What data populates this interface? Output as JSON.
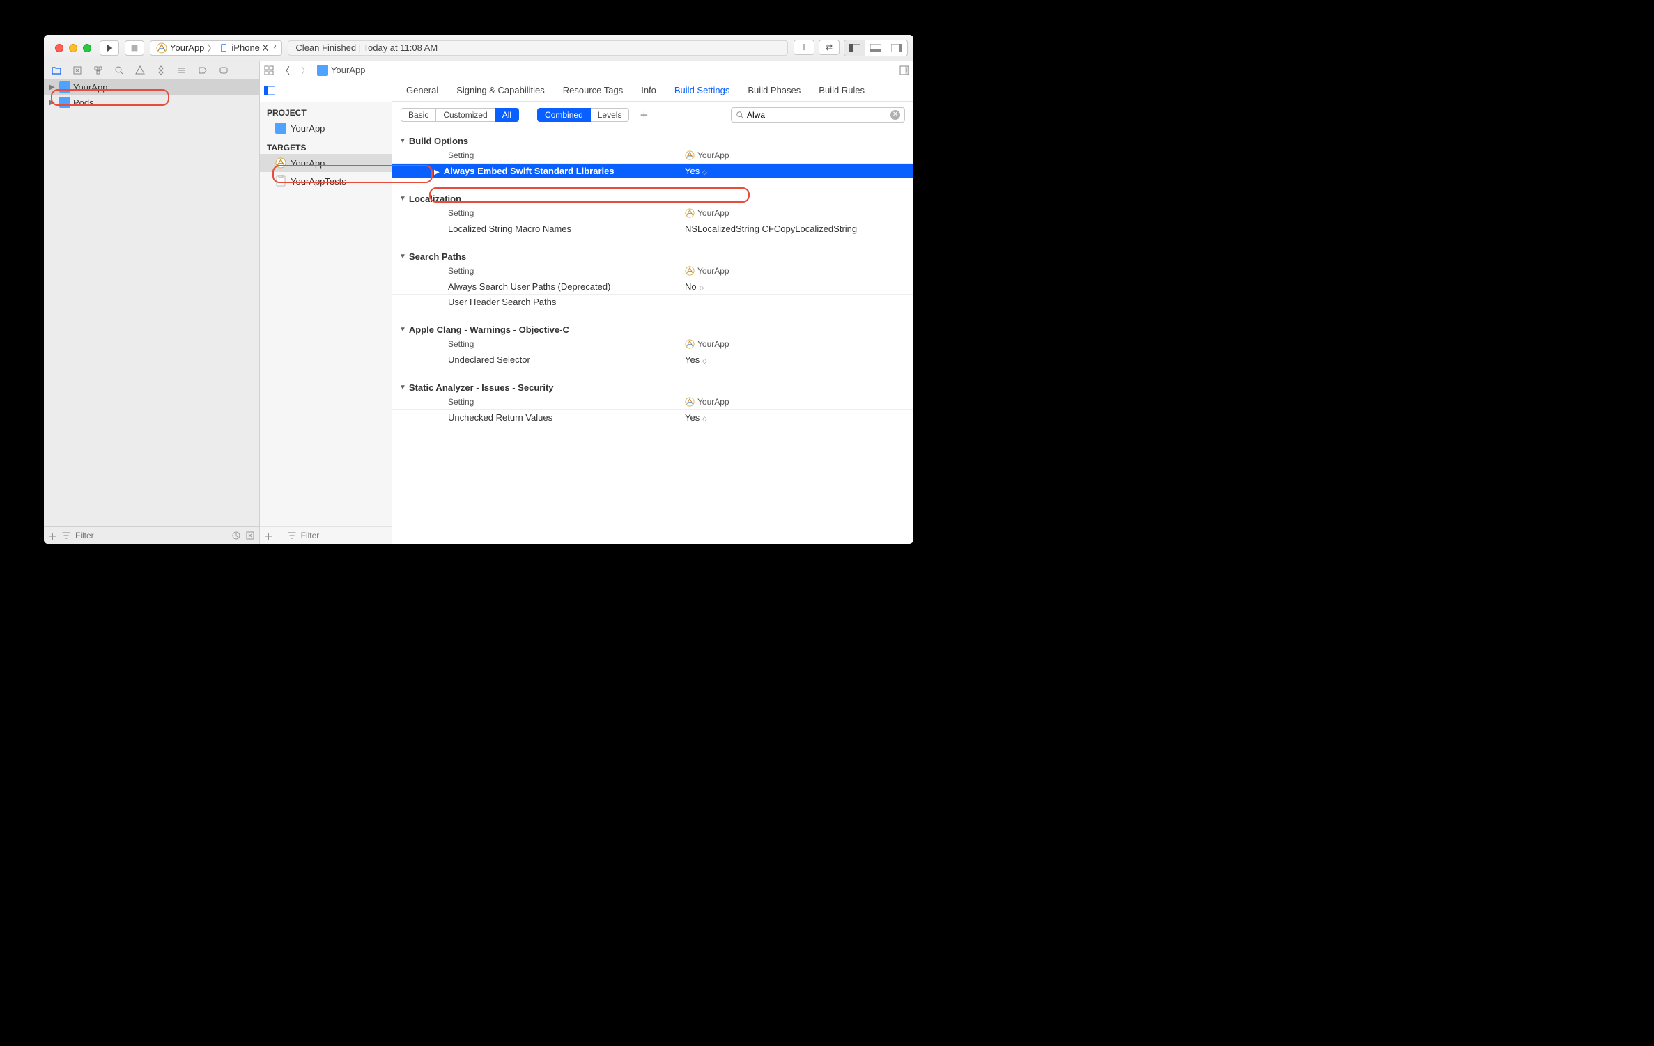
{
  "scheme": {
    "app": "YourApp",
    "device": "iPhone X",
    "device_suffix": "R"
  },
  "status": "Clean Finished | Today at 11:08 AM",
  "navigator": {
    "items": [
      {
        "label": "YourApp",
        "selected": true
      },
      {
        "label": "Pods",
        "selected": false
      }
    ],
    "filter_placeholder": "Filter"
  },
  "jumpbar": {
    "file": "YourApp"
  },
  "targets_panel": {
    "project_label": "PROJECT",
    "project": "YourApp",
    "targets_label": "TARGETS",
    "targets": [
      {
        "label": "YourApp",
        "selected": true,
        "icon": "app"
      },
      {
        "label": "YourAppTests",
        "selected": false,
        "icon": "test"
      }
    ],
    "filter_placeholder": "Filter"
  },
  "tabs": [
    "General",
    "Signing & Capabilities",
    "Resource Tags",
    "Info",
    "Build Settings",
    "Build Phases",
    "Build Rules"
  ],
  "active_tab": "Build Settings",
  "filterbar": {
    "scope": [
      "Basic",
      "Customized",
      "All"
    ],
    "scope_active": "All",
    "view": [
      "Combined",
      "Levels"
    ],
    "view_active": "Combined",
    "search_value": "Alwa"
  },
  "columns": {
    "setting": "Setting",
    "target": "YourApp"
  },
  "sections": [
    {
      "title": "Build Options",
      "rows": [
        {
          "name": "Always Embed Swift Standard Libraries",
          "value": "Yes",
          "highlight": true,
          "dropdown": true,
          "disclosure": true
        }
      ]
    },
    {
      "title": "Localization",
      "rows": [
        {
          "name": "Localized String Macro Names",
          "value": "NSLocalizedString CFCopyLocalizedString"
        }
      ]
    },
    {
      "title": "Search Paths",
      "rows": [
        {
          "name": "Always Search User Paths (Deprecated)",
          "value": "No",
          "dropdown": true
        },
        {
          "name": "User Header Search Paths",
          "value": ""
        }
      ]
    },
    {
      "title": "Apple Clang - Warnings - Objective-C",
      "rows": [
        {
          "name": "Undeclared Selector",
          "value": "Yes",
          "dropdown": true
        }
      ]
    },
    {
      "title": "Static Analyzer - Issues - Security",
      "rows": [
        {
          "name": "Unchecked Return Values",
          "value": "Yes",
          "dropdown": true
        }
      ]
    }
  ]
}
